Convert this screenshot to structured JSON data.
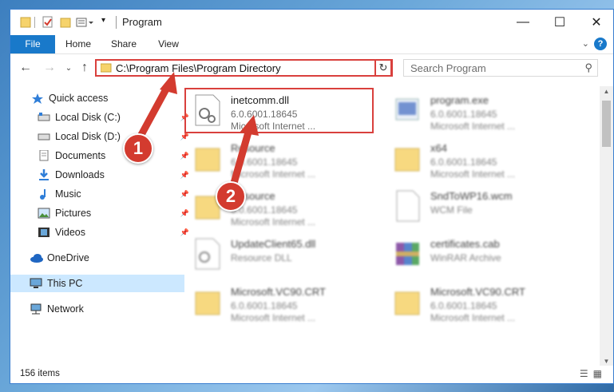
{
  "window": {
    "title": "Program",
    "controls": {
      "minimize": "—",
      "maximize": "☐",
      "close": "✕"
    }
  },
  "ribbon": {
    "tabs": [
      "File",
      "Home",
      "Share",
      "View"
    ],
    "help": "?"
  },
  "address": {
    "path": "C:\\Program Files\\Program Directory",
    "refresh": "↻"
  },
  "search": {
    "placeholder": "Search Program"
  },
  "nav": {
    "items": [
      {
        "label": "Quick access"
      },
      {
        "label": "Local Disk (C:)"
      },
      {
        "label": "Local Disk (D:)"
      },
      {
        "label": "Documents"
      },
      {
        "label": "Downloads"
      },
      {
        "label": "Music"
      },
      {
        "label": "Pictures"
      },
      {
        "label": "Videos"
      },
      {
        "label": "OneDrive"
      },
      {
        "label": "This PC"
      },
      {
        "label": "Network"
      }
    ]
  },
  "files": [
    {
      "name": "inetcomm.dll",
      "d1": "6.0.6001.18645",
      "d2": "Microsoft Internet ...",
      "icon": "dll-icon"
    },
    {
      "name": "program.exe",
      "d1": "6.0.6001.18645",
      "d2": "Microsoft Internet ...",
      "icon": "exe-icon"
    },
    {
      "name": "Resource",
      "d1": "6.0.6001.18645",
      "d2": "Microsoft Internet ...",
      "icon": "folder-icon"
    },
    {
      "name": "x64",
      "d1": "6.0.6001.18645",
      "d2": "Microsoft Internet ...",
      "icon": "folder-icon"
    },
    {
      "name": "Resource",
      "d1": "6.0.6001.18645",
      "d2": "Microsoft Internet ...",
      "icon": "folder-icon"
    },
    {
      "name": "SndToWP16.wcm",
      "d1": "WCM File",
      "d2": "",
      "icon": "file-icon"
    },
    {
      "name": "UpdateClient65.dll",
      "d1": "Resource DLL",
      "d2": "",
      "icon": "dll-icon"
    },
    {
      "name": "certificates.cab",
      "d1": "WinRAR Archive",
      "d2": "",
      "icon": "archive-icon"
    },
    {
      "name": "Microsoft.VC90.CRT",
      "d1": "6.0.6001.18645",
      "d2": "Microsoft Internet ...",
      "icon": "folder-icon"
    },
    {
      "name": "Microsoft.VC90.CRT",
      "d1": "6.0.6001.18645",
      "d2": "Microsoft Internet ...",
      "icon": "folder-icon"
    }
  ],
  "status": {
    "count": "156 items"
  },
  "callouts": [
    "1",
    "2"
  ],
  "colors": {
    "accent": "#1979ca",
    "highlight": "#d9403d",
    "selection": "#cce8ff"
  }
}
